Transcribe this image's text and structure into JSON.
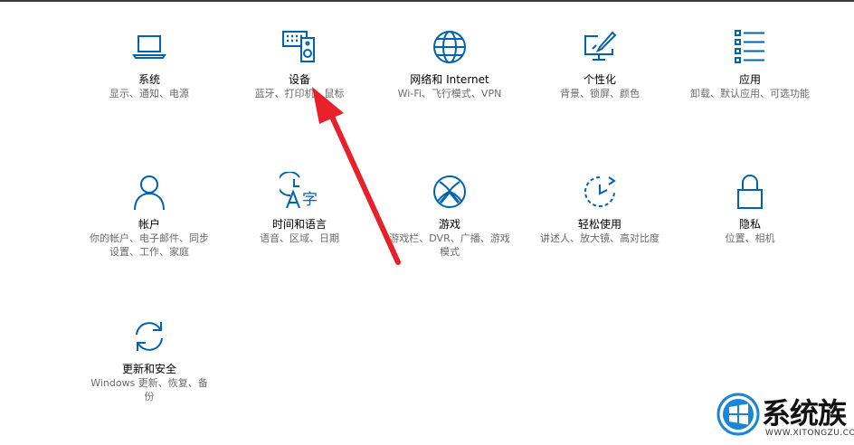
{
  "settings": {
    "tiles": [
      {
        "title": "系统",
        "desc": "显示、通知、电源",
        "icon": "laptop-icon"
      },
      {
        "title": "设备",
        "desc": "蓝牙、打印机、鼠标",
        "icon": "keyboard-speaker-icon"
      },
      {
        "title": "网络和 Internet",
        "desc": "Wi-Fi、飞行模式、VPN",
        "icon": "globe-icon"
      },
      {
        "title": "个性化",
        "desc": "背景、锁屏、颜色",
        "icon": "paint-monitor-icon"
      },
      {
        "title": "应用",
        "desc": "卸载、默认应用、可选功能",
        "icon": "list-icon"
      },
      {
        "title": "帐户",
        "desc": "你的帐户、电子邮件、同步设置、工作、家庭",
        "icon": "person-icon"
      },
      {
        "title": "时间和语言",
        "desc": "语音、区域、日期",
        "icon": "time-language-icon"
      },
      {
        "title": "游戏",
        "desc": "游戏栏、DVR、广播、游戏模式",
        "icon": "xbox-icon"
      },
      {
        "title": "轻松使用",
        "desc": "讲述人、放大镜、高对比度",
        "icon": "ease-of-access-icon"
      },
      {
        "title": "隐私",
        "desc": "位置、相机",
        "icon": "lock-icon"
      },
      {
        "title": "更新和安全",
        "desc": "Windows 更新、恢复、备份",
        "icon": "sync-icon"
      }
    ]
  },
  "watermark": {
    "brand": "系统族",
    "url": "WWW.XITONGZU.COM"
  },
  "colors": {
    "icon_blue": "#0063B1",
    "arrow_red": "#E8202A"
  }
}
